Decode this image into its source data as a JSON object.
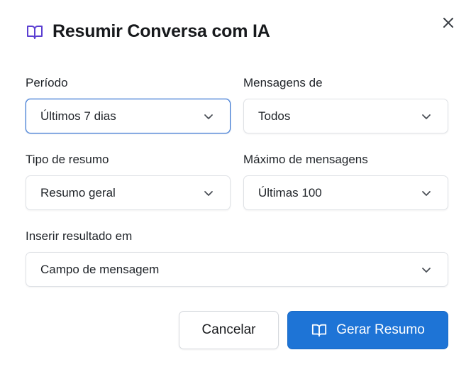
{
  "dialog": {
    "title": "Resumir Conversa com IA",
    "close_icon": "close-icon",
    "title_icon": "book-open-icon"
  },
  "fields": {
    "periodo": {
      "label": "Período",
      "value": "Últimos 7 dias"
    },
    "mensagens_de": {
      "label": "Mensagens de",
      "value": "Todos"
    },
    "tipo_resumo": {
      "label": "Tipo de resumo",
      "value": "Resumo geral"
    },
    "maximo_mensagens": {
      "label": "Máximo de mensagens",
      "value": "Últimas 100"
    },
    "inserir_resultado": {
      "label": "Inserir resultado em",
      "value": "Campo de mensagem"
    }
  },
  "buttons": {
    "cancel_label": "Cancelar",
    "generate_label": "Gerar Resumo"
  },
  "colors": {
    "primary": "#1e74d6",
    "focus_border": "#2f6fd1",
    "icon_purple": "#5b3fd1"
  }
}
